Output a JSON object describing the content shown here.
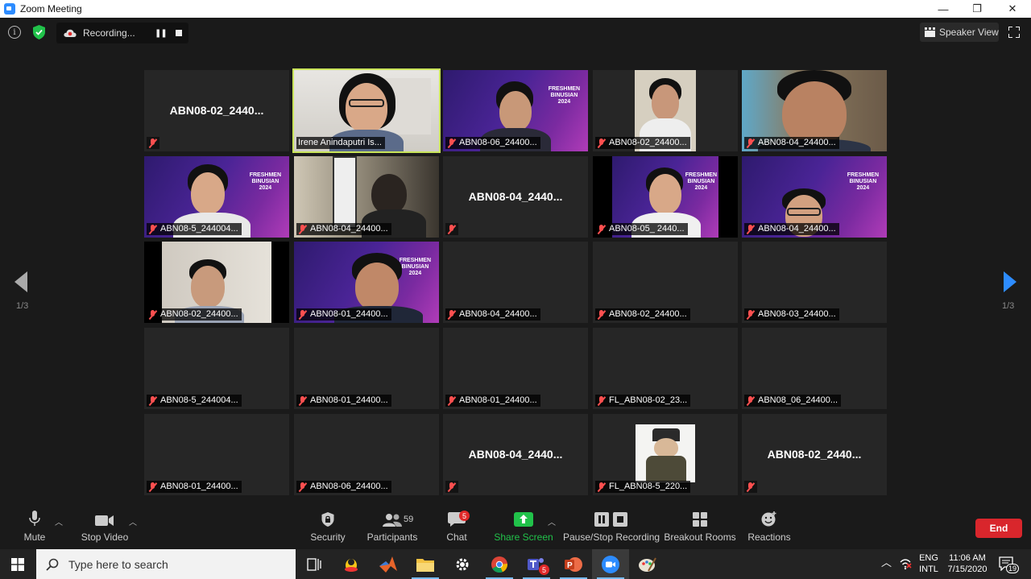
{
  "window": {
    "title": "Zoom Meeting",
    "minimize": "—",
    "restore": "❐",
    "close": "✕"
  },
  "topbar": {
    "info": "i",
    "recording_label": "Recording...",
    "speaker_view_label": "Speaker View"
  },
  "tiles": [
    {
      "name": "ABN08-02_2440...",
      "video": false
    },
    {
      "name": "Irene Anindaputri Is...",
      "video": true,
      "active": true,
      "muted": false
    },
    {
      "name": "ABN08-06_24400...",
      "video": true
    },
    {
      "name": "ABN08-02_24400...",
      "video": true
    },
    {
      "name": "ABN08-04_24400...",
      "video": true
    },
    {
      "name": "ABN08-5_244004...",
      "video": true
    },
    {
      "name": "ABN08-04_24400...",
      "video": true
    },
    {
      "name": "ABN08-04_2440...",
      "video": false
    },
    {
      "name": "ABN08-05_ 2440...",
      "video": true
    },
    {
      "name": "ABN08-04_24400...",
      "video": true
    },
    {
      "name": "ABN08-02_24400...",
      "video": true
    },
    {
      "name": "ABN08-01_24400...",
      "video": true
    },
    {
      "name": "ABN08-04_24400...",
      "video": false,
      "label_only": true
    },
    {
      "name": "ABN08-02_24400...",
      "video": false,
      "label_only": true
    },
    {
      "name": "ABN08-03_24400...",
      "video": false,
      "label_only": true
    },
    {
      "name": "ABN08-5_244004...",
      "video": false,
      "label_only": true
    },
    {
      "name": "ABN08-01_24400...",
      "video": false,
      "label_only": true
    },
    {
      "name": "ABN08-01_24400...",
      "video": false,
      "label_only": true
    },
    {
      "name": "FL_ABN08-02_23...",
      "video": false,
      "label_only": true
    },
    {
      "name": "ABN08_06_24400...",
      "video": false,
      "label_only": true
    },
    {
      "name": "ABN08-01_24400...",
      "video": false,
      "label_only": true
    },
    {
      "name": "ABN08-06_24400...",
      "video": false,
      "label_only": true
    },
    {
      "name": "ABN08-04_2440...",
      "video": false
    },
    {
      "name": "FL_ABN08-5_220...",
      "video": true
    },
    {
      "name": "ABN08-02_2440...",
      "video": false
    }
  ],
  "freshmen_text": "FRESHMEN\nBINUSIAN\n2024",
  "pagination": {
    "left": "1/3",
    "right": "1/3"
  },
  "toolbar": {
    "mute": "Mute",
    "stop_video": "Stop Video",
    "security": "Security",
    "participants": "Participants",
    "participants_count": "59",
    "chat": "Chat",
    "chat_badge": "5",
    "share_screen": "Share Screen",
    "pause_stop_recording": "Pause/Stop Recording",
    "breakout_rooms": "Breakout Rooms",
    "reactions": "Reactions",
    "end": "End"
  },
  "taskbar": {
    "search_placeholder": "Type here to search",
    "lang_top": "ENG",
    "lang_bottom": "INTL",
    "time": "11:06 AM",
    "date": "7/15/2020",
    "notifications_count": "19",
    "teams_badge": "5"
  },
  "colors": {
    "accent": "#2d8cff",
    "share_green": "#21c24a",
    "end_red": "#d9262c",
    "active_border": "#c9e45a",
    "muted_red": "#ff5050"
  }
}
